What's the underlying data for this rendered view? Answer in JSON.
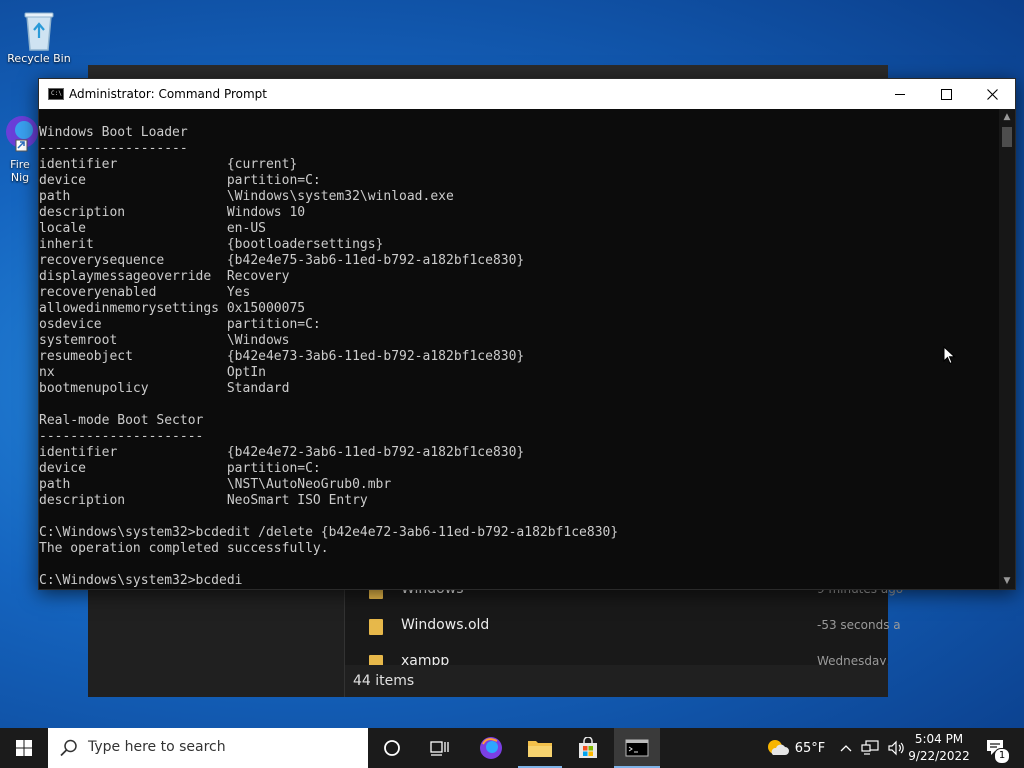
{
  "desktop": {
    "recycle_bin_label": "Recycle Bin",
    "firefox_label_line1": "Fire",
    "firefox_label_line2": "Nig"
  },
  "explorer": {
    "files": [
      {
        "name": "Windows",
        "date": "9 minutes ago"
      },
      {
        "name": "Windows.old",
        "date": "-53 seconds a"
      },
      {
        "name": "xampp",
        "date": "Wednesday, A"
      }
    ],
    "status": "44 items"
  },
  "cmd": {
    "title": "Administrator: Command Prompt",
    "icon_text": "C:\\",
    "console_lines": [
      "Windows Boot Loader",
      "-------------------",
      "identifier              {current}",
      "device                  partition=C:",
      "path                    \\Windows\\system32\\winload.exe",
      "description             Windows 10",
      "locale                  en-US",
      "inherit                 {bootloadersettings}",
      "recoverysequence        {b42e4e75-3ab6-11ed-b792-a182bf1ce830}",
      "displaymessageoverride  Recovery",
      "recoveryenabled         Yes",
      "allowedinmemorysettings 0x15000075",
      "osdevice                partition=C:",
      "systemroot              \\Windows",
      "resumeobject            {b42e4e73-3ab6-11ed-b792-a182bf1ce830}",
      "nx                      OptIn",
      "bootmenupolicy          Standard",
      "",
      "Real-mode Boot Sector",
      "---------------------",
      "identifier              {b42e4e72-3ab6-11ed-b792-a182bf1ce830}",
      "device                  partition=C:",
      "path                    \\NST\\AutoNeoGrub0.mbr",
      "description             NeoSmart ISO Entry",
      "",
      "C:\\Windows\\system32>bcdedit /delete {b42e4e72-3ab6-11ed-b792-a182bf1ce830}",
      "The operation completed successfully.",
      "",
      "C:\\Windows\\system32>bcdedi"
    ]
  },
  "taskbar": {
    "search_placeholder": "Type here to search",
    "weather_temp": "65°F",
    "time": "5:04 PM",
    "date": "9/22/2022",
    "notification_count": "1"
  },
  "colors": {
    "desktop_blue": "#1565c0",
    "console_bg": "#0c0c0c",
    "console_text": "#cccccc",
    "taskbar_bg": "#1b1b1b"
  }
}
